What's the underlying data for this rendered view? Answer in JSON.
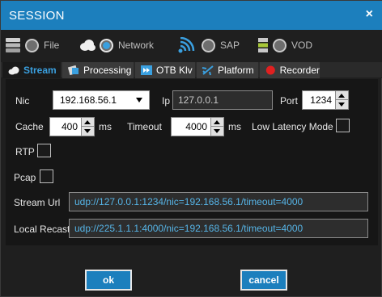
{
  "window": {
    "title": "SESSION",
    "close_glyph": "×"
  },
  "sources": [
    {
      "label": "File",
      "icon": "storage-icon",
      "selected": false
    },
    {
      "label": "Network",
      "icon": "cloud-icon",
      "selected": true
    },
    {
      "label": "SAP",
      "icon": "wifi-icon",
      "selected": false
    },
    {
      "label": "VOD",
      "icon": "server-icon",
      "selected": false
    }
  ],
  "tabs": [
    {
      "label": "Stream",
      "icon": "cloud-icon",
      "active": true
    },
    {
      "label": "Processing",
      "icon": "processing-icon",
      "active": false
    },
    {
      "label": "OTB Klv",
      "icon": "otb-icon",
      "active": false
    },
    {
      "label": "Platform",
      "icon": "plane-icon",
      "active": false
    },
    {
      "label": "Recorder",
      "icon": "record-icon",
      "active": false
    }
  ],
  "form": {
    "nic_label": "Nic",
    "nic_value": "192.168.56.1",
    "ip_label": "Ip",
    "ip_value": "127.0.0.1",
    "port_label": "Port",
    "port_value": "1234",
    "cache_label": "Cache",
    "cache_value": "400",
    "cache_unit": "ms",
    "timeout_label": "Timeout",
    "timeout_value": "4000",
    "timeout_unit": "ms",
    "low_latency_label": "Low Latency Mode",
    "rtp_label": "RTP",
    "pcap_label": "Pcap",
    "stream_url_label": "Stream Url",
    "stream_url_value": "udp://127.0.0.1:1234/nic=192.168.56.1/timeout=4000",
    "local_recast_label": "Local Recast",
    "local_recast_value": "udp://225.1.1.1:4000/nic=192.168.56.1/timeout=4000"
  },
  "buttons": {
    "ok": "ok",
    "cancel": "cancel"
  },
  "colors": {
    "accent": "#1c7fbd",
    "link": "#56b4e6",
    "record": "#e02020"
  }
}
